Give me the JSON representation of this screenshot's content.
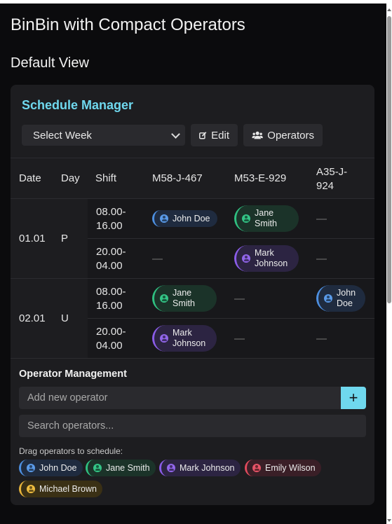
{
  "page": {
    "title": "BinBin with Compact Operators",
    "view_title": "Default View"
  },
  "schedule": {
    "title": "Schedule Manager",
    "week_select": "Select Week",
    "edit_label": "Edit",
    "operators_label": "Operators",
    "columns": [
      "Date",
      "Day",
      "Shift",
      "M58-J-467",
      "M53-E-929",
      "A35-J-924"
    ],
    "groups": [
      {
        "date": "01.01",
        "day": "P",
        "rows": [
          {
            "shift_start": "08.00-",
            "shift_end": "16.00",
            "cells": [
              {
                "name": "John Doe",
                "color": "blue"
              },
              {
                "name": "Jane Smith",
                "color": "green"
              },
              {
                "empty": "—"
              }
            ]
          },
          {
            "shift_start": "20.00-",
            "shift_end": "04.00",
            "cells": [
              {
                "empty": "—"
              },
              {
                "name": "Mark Johnson",
                "color": "purple"
              },
              {
                "empty": "—"
              }
            ]
          }
        ]
      },
      {
        "date": "02.01",
        "day": "U",
        "rows": [
          {
            "shift_start": "08.00-",
            "shift_end": "16.00",
            "cells": [
              {
                "name": "Jane Smith",
                "color": "green"
              },
              {
                "empty": "—"
              },
              {
                "name": "John Doe",
                "color": "blue"
              }
            ]
          },
          {
            "shift_start": "20.00-",
            "shift_end": "04.00",
            "cells": [
              {
                "name": "Mark Johnson",
                "color": "purple"
              },
              {
                "empty": "—"
              },
              {
                "empty": "—"
              }
            ]
          }
        ]
      }
    ]
  },
  "operator_management": {
    "title": "Operator Management",
    "add_placeholder": "Add new operator",
    "add_button": "+",
    "search_placeholder": "Search operators...",
    "drag_label": "Drag operators to schedule:",
    "operators": [
      {
        "name": "John Doe",
        "color": "blue"
      },
      {
        "name": "Jane Smith",
        "color": "green"
      },
      {
        "name": "Mark Johnson",
        "color": "purple"
      },
      {
        "name": "Emily Wilson",
        "color": "red"
      },
      {
        "name": "Michael Brown",
        "color": "yellow"
      }
    ]
  },
  "colors": {
    "accent": "#6fd8ee",
    "blue": "#4d8fe0",
    "green": "#2fbf80",
    "purple": "#8a5ce8",
    "red": "#e04a5c",
    "yellow": "#e6b33a"
  }
}
